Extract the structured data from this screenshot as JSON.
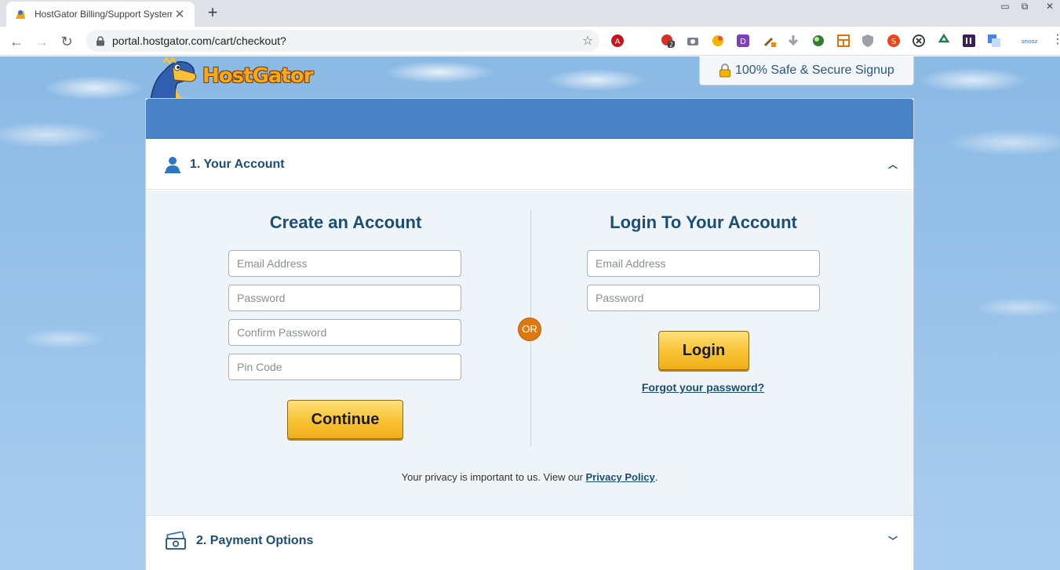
{
  "browser": {
    "tab_title": "HostGator Billing/Support System",
    "tab_close": "✕",
    "new_tab": "+",
    "url": "portal.hostgator.com/cart/checkout?",
    "window_controls": {
      "minimize": "▭",
      "maximize": "⧉",
      "close": "✕"
    },
    "nav": {
      "back": "←",
      "forward": "→",
      "reload": "↻",
      "star": "☆",
      "menu": "⋮"
    },
    "extension_icons": [
      "adblock-icon",
      "notification-badge-icon",
      "camera-icon",
      "color-icon",
      "d-extension-icon",
      "tool-icon",
      "download-icon",
      "globe-icon",
      "layout-icon",
      "shield-icon",
      "s-extension-icon",
      "x-circle-icon",
      "recycle-icon",
      "ii-extension-icon",
      "translate-icon",
      "snooz-icon"
    ],
    "extension_badge": "2",
    "extension_label_snooz": "snooz"
  },
  "header": {
    "logo_text": "HostGator",
    "secure_label": "100% Safe & Secure Signup"
  },
  "sections": [
    {
      "title": "1. Your Account",
      "icon": "user-icon",
      "expanded": true
    },
    {
      "title": "2. Payment Options",
      "icon": "money-icon",
      "expanded": false
    }
  ],
  "create_account": {
    "heading": "Create an Account",
    "email_placeholder": "Email Address",
    "password_placeholder": "Password",
    "confirm_placeholder": "Confirm Password",
    "pin_placeholder": "Pin Code",
    "button": "Continue"
  },
  "or_label": "OR",
  "login": {
    "heading": "Login To Your Account",
    "email_placeholder": "Email Address",
    "password_placeholder": "Password",
    "button": "Login",
    "forgot": "Forgot your password?"
  },
  "privacy": {
    "text": "Your privacy is important to us. View our ",
    "link": "Privacy Policy",
    "end": "."
  },
  "colors": {
    "brand_blue": "#4a82c8",
    "heading_navy": "#1c4e74",
    "button_gold": "#f8c232",
    "or_orange": "#e07812"
  }
}
